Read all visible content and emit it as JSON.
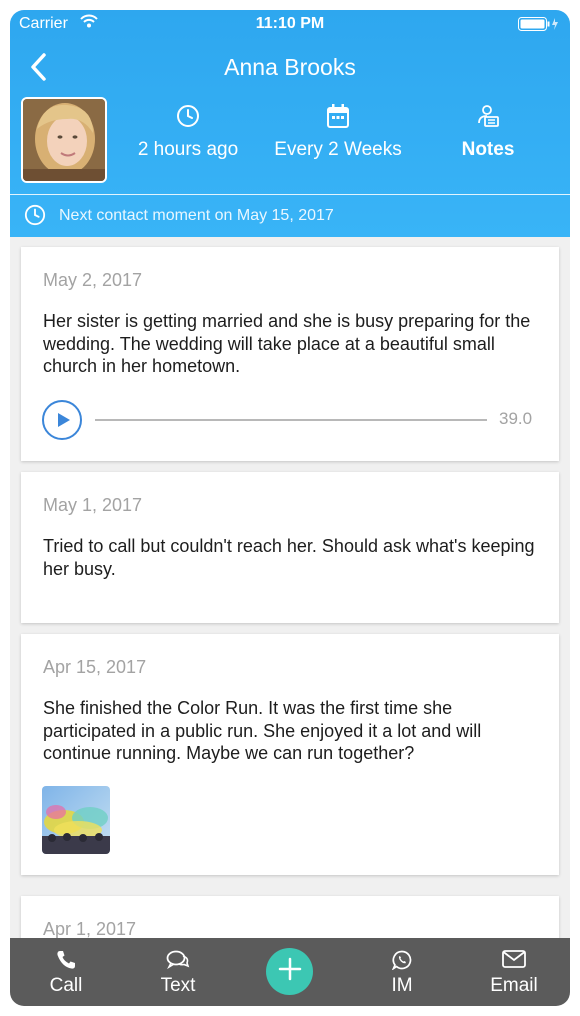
{
  "status_bar": {
    "carrier": "Carrier",
    "time": "11:10 PM"
  },
  "nav": {
    "title": "Anna Brooks"
  },
  "stats": [
    {
      "icon": "clock-icon",
      "label": "2 hours ago"
    },
    {
      "icon": "calendar-icon",
      "label": "Every 2 Weeks"
    },
    {
      "icon": "notes-icon",
      "label": "Notes"
    }
  ],
  "next_contact": {
    "text": "Next contact moment on May 15, 2017"
  },
  "entries": [
    {
      "date": "May 2, 2017",
      "text": "Her sister is getting married and she is busy preparing for the wedding. The wedding will take place at a beautiful small church in her hometown.",
      "audio_duration": "39.0",
      "audio_progress": 0
    },
    {
      "date": "May 1, 2017",
      "text": "Tried to call but couldn't reach her. Should ask what's keeping her busy."
    },
    {
      "date": "Apr 15, 2017",
      "text": "She finished the Color Run. It was the first time she participated in a public run. She enjoyed it a lot and will continue running. Maybe we can run together?"
    },
    {
      "date": "Apr 1, 2017"
    }
  ],
  "tabs": [
    {
      "label": "Call",
      "icon": "phone-icon"
    },
    {
      "label": "Text",
      "icon": "chat-icon"
    },
    {
      "label": "",
      "icon": "plus-icon"
    },
    {
      "label": "IM",
      "icon": "whatsapp-icon"
    },
    {
      "label": "Email",
      "icon": "email-icon"
    }
  ],
  "colors": {
    "header": "#39b4f7",
    "tabbar": "#5b5b5b",
    "fab": "#3cc7b3",
    "play": "#3b86d9"
  }
}
